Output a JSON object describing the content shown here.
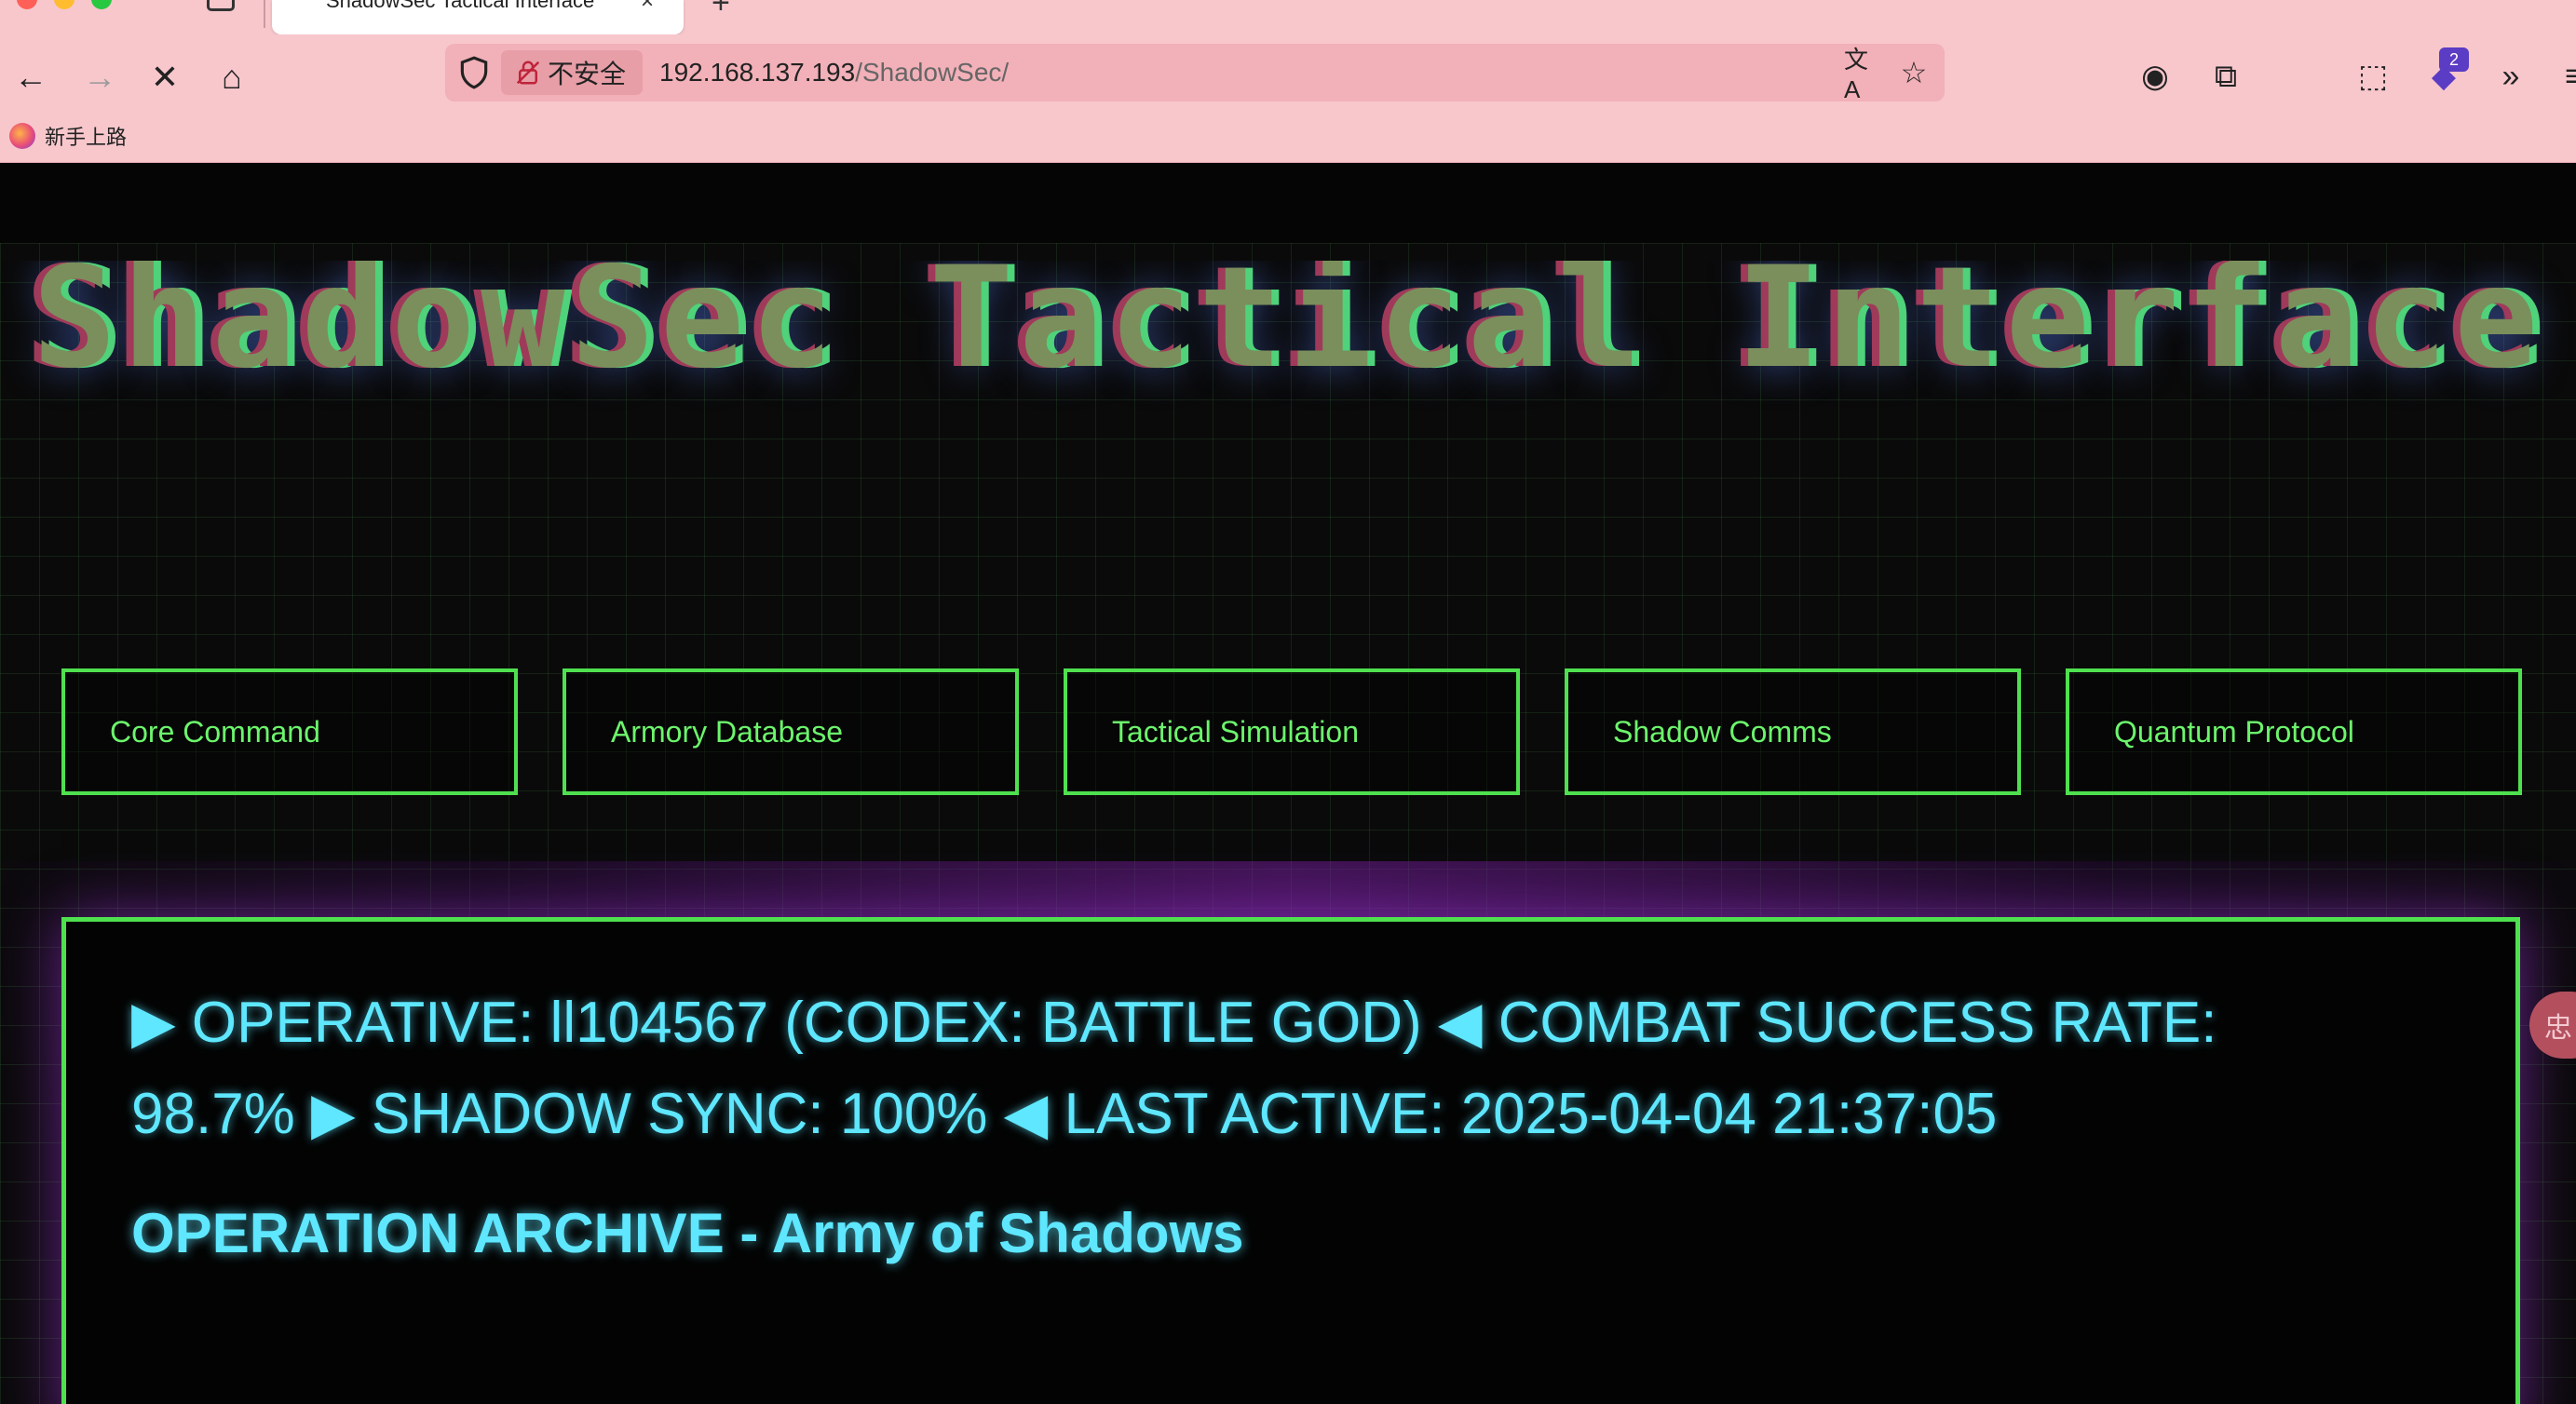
{
  "browser": {
    "tab_title": "ShadowSec Tactical Interface",
    "tab_close": "×",
    "tab_new": "+",
    "security_label": "不安全",
    "url_host": "192.168.137.193",
    "url_path": "/ShadowSec/",
    "extension_badge": "2",
    "bookmark_label": "新手上路",
    "icons": {
      "back": "←",
      "forward": "→",
      "stop": "✕",
      "home": "⌂",
      "translate": "文A",
      "star": "☆",
      "account": "◉",
      "crop": "⧉",
      "extensions": "⬚",
      "overflow": "»",
      "menu": "≡"
    }
  },
  "page": {
    "title": "ShadowSec Tactical Interface",
    "nav": [
      {
        "label": "Core Command"
      },
      {
        "label": "Armory Database"
      },
      {
        "label": "Tactical Simulation"
      },
      {
        "label": "Shadow Comms"
      },
      {
        "label": "Quantum Protocol"
      }
    ],
    "status_line": "▶ OPERATIVE: ll104567 (CODEX: BATTLE GOD) ◀ COMBAT SUCCESS RATE: 98.7% ▶ SHADOW SYNC: 100% ◀ LAST ACTIVE: 2025-04-04 21:37:05",
    "archive_heading": "OPERATION ARCHIVE - Army of Shadows",
    "side_widget": "忠"
  },
  "colors": {
    "chrome": "#f7c7cc",
    "urlbar": "#f2b0b8",
    "neon_green": "#4fe04f",
    "neon_cyan": "#5ee7ff",
    "glow_purple": "#7a1ea0"
  }
}
